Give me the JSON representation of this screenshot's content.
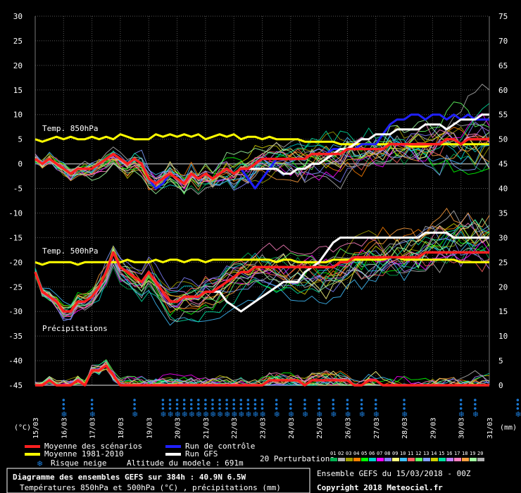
{
  "chart_data": {
    "type": "line",
    "left_axis": {
      "label": "(°C)",
      "ticks": [
        30,
        25,
        20,
        15,
        10,
        5,
        0,
        -5,
        -10,
        -15,
        -20,
        -25,
        -30,
        -35,
        -40,
        -45
      ],
      "range": [
        -45,
        30
      ]
    },
    "right_axis": {
      "label": "(mm)",
      "ticks": [
        75,
        70,
        65,
        60,
        55,
        50,
        45,
        40,
        35,
        30,
        25,
        20,
        15,
        10,
        5,
        0
      ]
    },
    "x_ticks": [
      "15/03",
      "16/03",
      "17/03",
      "18/03",
      "19/03",
      "20/03",
      "21/03",
      "22/03",
      "23/03",
      "24/03",
      "25/03",
      "26/03",
      "27/03",
      "28/03",
      "29/03",
      "30/03",
      "31/03"
    ],
    "panel_labels": {
      "t850": "Temp. 850hPa",
      "t500": "Temp. 500hPa",
      "precip": "Précipitations"
    },
    "grid": true,
    "x_step_hours": 6,
    "series": [
      {
        "name": "Moyenne des scénarios",
        "color": "#ff2020",
        "role": "mean850",
        "values": [
          1,
          0,
          1,
          0,
          -1,
          -2,
          -1,
          -1,
          -1,
          0,
          1,
          2,
          1,
          0,
          1,
          0,
          -3,
          -4,
          -3,
          -2,
          -3,
          -4,
          -2,
          -3,
          -2,
          -3,
          -2,
          -1,
          -2,
          -1,
          -1,
          0,
          1,
          1,
          1,
          1,
          1,
          1,
          1,
          2,
          2,
          2,
          2,
          2,
          3,
          3,
          3,
          3,
          3,
          3,
          4,
          4,
          4,
          4,
          4,
          4,
          4,
          4,
          5,
          5,
          4,
          5,
          5,
          5,
          5
        ]
      },
      {
        "name": "Moyenne 1981-2010",
        "color": "#ffff00",
        "role": "clim850",
        "values": [
          5,
          4.5,
          5,
          5.5,
          5,
          5.5,
          5,
          5,
          5.5,
          5,
          5.5,
          5,
          6,
          5.5,
          5,
          5,
          5,
          6,
          5.5,
          6,
          5.5,
          6,
          5.5,
          6,
          5,
          5.5,
          6,
          5.5,
          6,
          5,
          5.5,
          5.5,
          5,
          5.5,
          5,
          5,
          5,
          5,
          4.5,
          4.5,
          4.5,
          4.5,
          4.5,
          4,
          4,
          4,
          4,
          4,
          4,
          4,
          4,
          4,
          4,
          3.5,
          3.5,
          3.5,
          4,
          4,
          4,
          4,
          4,
          4,
          4,
          4,
          4
        ]
      },
      {
        "name": "Run de contrôle",
        "color": "#2020ff",
        "role": "ctrl850",
        "values": [
          1,
          0,
          1,
          0,
          -1,
          -2,
          -1,
          -1,
          -1,
          0,
          1,
          2,
          1,
          0,
          1,
          0,
          -3,
          -5,
          -4,
          -2,
          -3,
          -4,
          -2,
          -3,
          -2,
          -3,
          -2,
          -1,
          -2,
          -1,
          -3,
          -5,
          -3,
          -1,
          1,
          1,
          1,
          1,
          1,
          2,
          2,
          2,
          3,
          3,
          3,
          3,
          4,
          4,
          4,
          6,
          8,
          9,
          9,
          10,
          10,
          9,
          10,
          10,
          9,
          10,
          9,
          10,
          9,
          9,
          9
        ]
      },
      {
        "name": "Run GFS",
        "color": "#ffffff",
        "role": "gfs850",
        "values": [
          1,
          0,
          1,
          0,
          -1,
          -2,
          -1,
          -1,
          -1,
          0,
          1,
          2,
          1,
          0,
          1,
          0,
          -3,
          -4,
          -3,
          -2,
          -3,
          -4,
          -2,
          -3,
          -2,
          -3,
          -2,
          -1,
          -2,
          -1,
          -1,
          -1,
          -1,
          -1,
          -1,
          -2,
          -2,
          -1,
          -1,
          0,
          0,
          1,
          2,
          3,
          3,
          4,
          5,
          5,
          6,
          6,
          6,
          7,
          7,
          7,
          7,
          8,
          8,
          8,
          7,
          8,
          9,
          9,
          9,
          10,
          10
        ]
      },
      {
        "name": "mean500",
        "color": "#ff2020",
        "role": "mean500",
        "values": [
          -22,
          -26,
          -27,
          -28,
          -30,
          -30,
          -28,
          -28,
          -27,
          -25,
          -22,
          -18,
          -21,
          -22,
          -23,
          -24,
          -22,
          -24,
          -26,
          -28,
          -28,
          -27,
          -27,
          -27,
          -26,
          -26,
          -25,
          -24,
          -23,
          -22,
          -22,
          -21,
          -21,
          -21,
          -21,
          -21,
          -21,
          -21,
          -21,
          -21,
          -21,
          -21,
          -21,
          -20,
          -20,
          -19,
          -19,
          -19,
          -19,
          -19,
          -19,
          -19,
          -19,
          -19,
          -19,
          -18,
          -18,
          -18,
          -18,
          -18,
          -18,
          -18,
          -18,
          -18,
          -18
        ]
      },
      {
        "name": "clim500",
        "color": "#ffff00",
        "role": "clim500",
        "values": [
          -20,
          -20.5,
          -20,
          -20,
          -20,
          -20,
          -20.5,
          -20,
          -20,
          -20,
          -20,
          -20,
          -20,
          -19.5,
          -20,
          -20,
          -20,
          -19.5,
          -20,
          -19.5,
          -19.5,
          -20,
          -19.5,
          -19.5,
          -20,
          -19.5,
          -19.5,
          -19.5,
          -19.5,
          -19.5,
          -19.5,
          -19.5,
          -19.5,
          -19.5,
          -20,
          -19.5,
          -19.5,
          -20,
          -20,
          -20,
          -20,
          -20,
          -19.5,
          -19.5,
          -19.5,
          -19.5,
          -19.5,
          -19.5,
          -19.5,
          -19.5,
          -19,
          -19,
          -19.5,
          -19.5,
          -19.5,
          -19.5,
          -19.5,
          -19.5,
          -19.5,
          -19.5,
          -20,
          -20,
          -20,
          -20,
          -20
        ]
      },
      {
        "name": "gfs500",
        "color": "#ffffff",
        "role": "gfs500",
        "values": [
          -22,
          -26,
          -27,
          -28,
          -30,
          -30,
          -28,
          -28,
          -27,
          -25,
          -22,
          -18,
          -21,
          -22,
          -23,
          -24,
          -22,
          -24,
          -26,
          -28,
          -28,
          -27,
          -27,
          -27,
          -26,
          -26,
          -26,
          -28,
          -29,
          -30,
          -29,
          -28,
          -27,
          -26,
          -25,
          -24,
          -24,
          -24,
          -22,
          -21,
          -20,
          -18,
          -16,
          -15,
          -15,
          -15,
          -15,
          -15,
          -15,
          -15,
          -15,
          -15,
          -15,
          -15,
          -15,
          -14,
          -14,
          -14,
          -14,
          -15,
          -15,
          -15,
          -15,
          -15,
          -15
        ]
      },
      {
        "name": "meanPrecip",
        "color": "#ff2020",
        "role": "meanPrecip",
        "values": [
          0,
          0,
          1,
          0,
          0,
          0,
          1,
          0,
          3,
          3,
          4,
          2,
          0,
          0,
          0,
          0,
          0,
          0,
          0,
          0,
          0,
          0,
          0,
          0,
          0,
          0,
          0,
          0,
          0,
          0,
          0,
          0,
          0,
          1,
          1,
          1,
          1,
          1,
          0,
          1,
          1,
          1,
          1,
          1,
          1,
          0,
          0,
          1,
          1,
          0,
          0,
          0,
          0,
          0,
          0,
          0,
          0,
          0,
          0,
          0,
          0,
          0,
          0,
          0,
          0
        ]
      }
    ],
    "legend": [
      {
        "label": "Moyenne des scénarios",
        "color": "#ff2020"
      },
      {
        "label": "Moyenne 1981-2010",
        "color": "#ffff00"
      },
      {
        "label": "Run de contrôle",
        "color": "#2020ff"
      },
      {
        "label": "Run GFS",
        "color": "#ffffff"
      },
      {
        "label": "Risque neige",
        "color": "#1a7ad6"
      },
      {
        "label": "Altitude du modele : 691m",
        "color": ""
      }
    ],
    "perturbations_label": "20 Perturbations",
    "perturbation_numbers": [
      "01",
      "02",
      "03",
      "04",
      "05",
      "06",
      "07",
      "08",
      "09",
      "10",
      "11",
      "12",
      "13",
      "14",
      "15",
      "16",
      "17",
      "18",
      "19",
      "20"
    ],
    "perturbation_colors": [
      "#00b050",
      "#b0b0b0",
      "#a0a000",
      "#ff8000",
      "#00ff00",
      "#00d0d0",
      "#ff00ff",
      "#8080ff",
      "#ffff80",
      "#40c0ff",
      "#ff6060",
      "#60ff60",
      "#80a0ff",
      "#d0d000",
      "#00e0a0",
      "#c080ff",
      "#ff80c0",
      "#ffa040",
      "#a0ffa0",
      "#b0b0b0"
    ],
    "snow_risk_steps": [
      4,
      8,
      14,
      18,
      19,
      20,
      21,
      22,
      23,
      24,
      25,
      26,
      27,
      28,
      29,
      30,
      31,
      32,
      34,
      36,
      38,
      40,
      42,
      44,
      46,
      48,
      52,
      60,
      62,
      68
    ]
  },
  "footer": {
    "title": "Diagramme des ensembles GEFS sur 384h : 40.9N 6.5W",
    "subtitle": "Températures 850hPa et 500hPa (°C) , précipitations (mm)",
    "ensemble": "Ensemble GEFS du 15/03/2018 - 00Z",
    "copyright": "Copyright 2018 Meteociel.fr"
  }
}
